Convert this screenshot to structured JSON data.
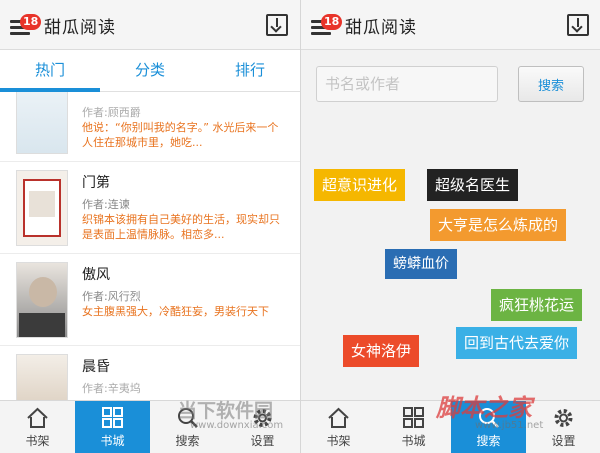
{
  "app": {
    "title": "甜瓜阅读",
    "badge_count": "18"
  },
  "tabs": [
    {
      "label": "热门",
      "active": true
    },
    {
      "label": "分类",
      "active": false
    },
    {
      "label": "排行",
      "active": false
    }
  ],
  "books": [
    {
      "title": "",
      "author": "作者:顾西爵",
      "desc": "他说：“你别叫我的名字。” 水光后来一个人住在那城市里，她吃..."
    },
    {
      "title": "门第",
      "author": "作者:连谏",
      "desc": "织锦本该拥有自己美好的生活，现实却只是表面上温情脉脉。相恋多..."
    },
    {
      "title": "傲风",
      "author": "作者:风行烈",
      "desc": "女主腹黑强大，冷酷狂妄，男装行天下"
    },
    {
      "title": "晨昏",
      "author": "作者:辛夷坞",
      "desc": ""
    }
  ],
  "nav_left": [
    {
      "label": "书架",
      "icon": "home-icon",
      "active": false
    },
    {
      "label": "书城",
      "icon": "grid-icon",
      "active": true
    },
    {
      "label": "搜索",
      "icon": "search-icon",
      "active": false
    },
    {
      "label": "设置",
      "icon": "gear-icon",
      "active": false
    }
  ],
  "nav_right": [
    {
      "label": "书架",
      "icon": "home-icon",
      "active": false
    },
    {
      "label": "书城",
      "icon": "grid-icon",
      "active": false
    },
    {
      "label": "搜索",
      "icon": "search-icon",
      "active": true
    },
    {
      "label": "设置",
      "icon": "gear-icon",
      "active": false
    }
  ],
  "search": {
    "placeholder": "书名或作者",
    "value": "",
    "button_label": "搜索"
  },
  "hot_tags": [
    {
      "label": "超意识进化",
      "color": "#f5b700"
    },
    {
      "label": "超级名医生",
      "color": "#222222"
    },
    {
      "label": "大亨是怎么炼成的",
      "color": "#f39a2f"
    },
    {
      "label": "螃蟒血价",
      "color": "#2a6db3"
    },
    {
      "label": "疯狂桃花运",
      "color": "#6cb443"
    },
    {
      "label": "女神洛伊",
      "color": "#ec4b2a"
    },
    {
      "label": "回到古代去爱你",
      "color": "#3ab0e6"
    }
  ],
  "watermarks": {
    "left_main": "当下软件园",
    "left_sub": "www.downxia.com",
    "right_main": "脚本之家",
    "right_sub": "www.jb51.net"
  },
  "colors": {
    "accent": "#1a8fd8",
    "desc_orange": "#e8731f",
    "badge_red": "#e8342a"
  }
}
